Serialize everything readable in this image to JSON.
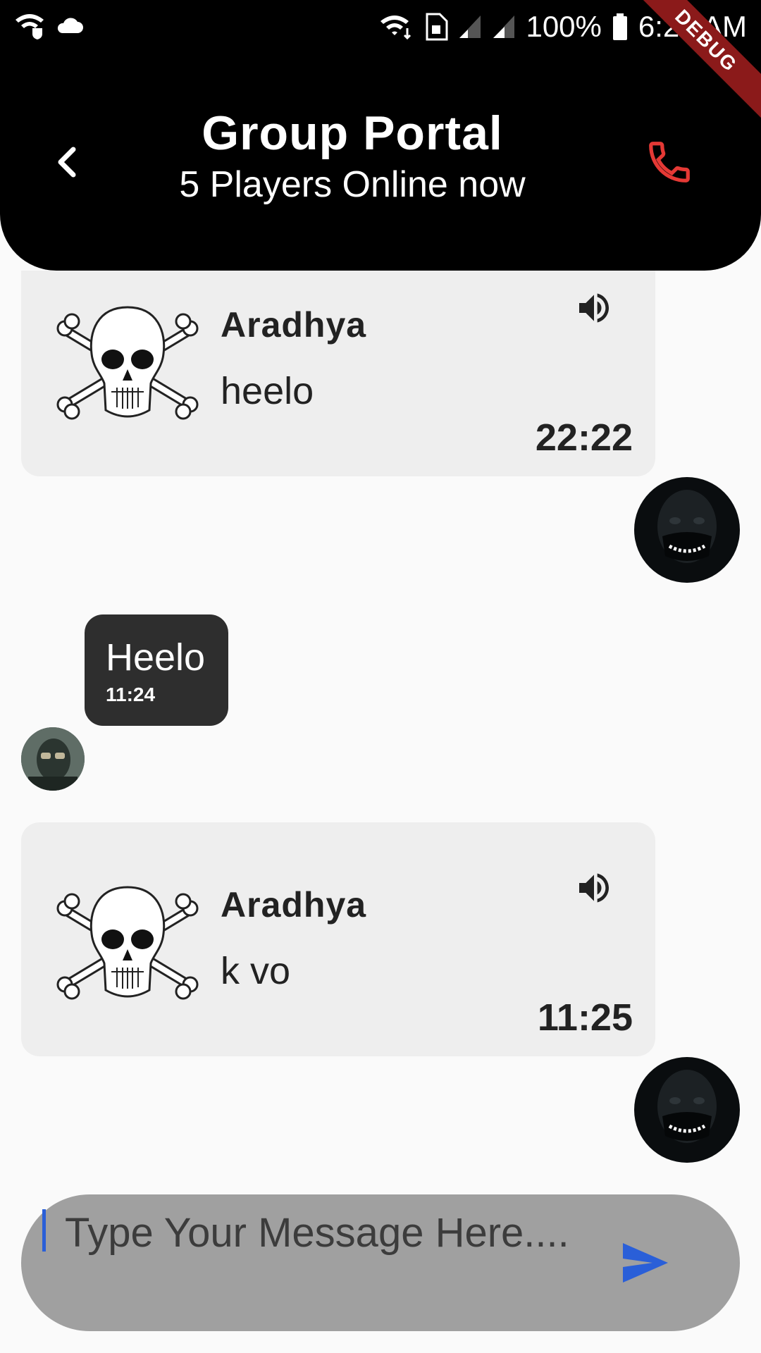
{
  "status_bar": {
    "battery": "100%",
    "time": "6:26 AM",
    "debug": "DEBUG"
  },
  "header": {
    "title": "Group Portal",
    "subtitle": "5 Players Online now"
  },
  "messages": [
    {
      "sender": "Aradhya",
      "text": "heelo",
      "time": "22:22"
    },
    {
      "text": "Heelo",
      "time": "11:24"
    },
    {
      "sender": "Aradhya",
      "text": "k vo",
      "time": "11:25"
    }
  ],
  "composer": {
    "placeholder": "Type Your Message Here...."
  },
  "colors": {
    "header_bg": "#000000",
    "call_icon": "#e53935",
    "send_icon": "#2a5fd8",
    "card_bg": "#eeeeee",
    "bubble_bg": "#2e2e2e",
    "input_bg": "#a0a0a0"
  }
}
